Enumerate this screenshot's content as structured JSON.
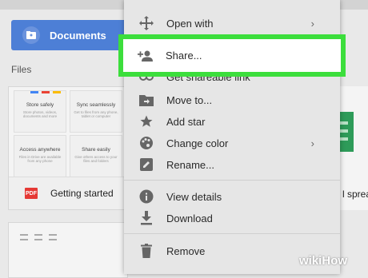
{
  "sidebar": {
    "documents_label": "Documents",
    "files_label": "Files"
  },
  "files": {
    "card1": {
      "thumbnails": [
        {
          "title": "Store safely",
          "desc": "Store photos, videos, documents and more",
          "colors": [
            "#4285f4",
            "#ea4335",
            "#fbbc05"
          ]
        },
        {
          "title": "Sync seamlessly",
          "desc": "Get to files from any phone, tablet or computer"
        },
        {
          "title": "Access anywhere",
          "desc": "Files in Drive are available from any phone"
        },
        {
          "title": "Share easily",
          "desc": "Give others access to your files and folders"
        }
      ],
      "badge": "PDF",
      "name": "Getting started"
    },
    "right_card_text": "l spread"
  },
  "menu": {
    "items": [
      {
        "label": "Open with",
        "icon": "move-icon",
        "arrow": "›"
      },
      {
        "label": "Share...",
        "icon": "add-person-icon"
      },
      {
        "label": "Get shareable link",
        "icon": "link-icon"
      },
      {
        "label": "Move to...",
        "icon": "folder-move-icon"
      },
      {
        "label": "Add star",
        "icon": "star-icon"
      },
      {
        "label": "Change color",
        "icon": "palette-icon",
        "arrow": "›"
      },
      {
        "label": "Rename...",
        "icon": "pencil-icon"
      },
      {
        "label": "View details",
        "icon": "info-icon"
      },
      {
        "label": "Download",
        "icon": "download-icon"
      },
      {
        "label": "Remove",
        "icon": "trash-icon"
      }
    ],
    "highlight_color": "#3cde3c"
  },
  "watermark": {
    "wiki": "wiki",
    "how": "How"
  }
}
